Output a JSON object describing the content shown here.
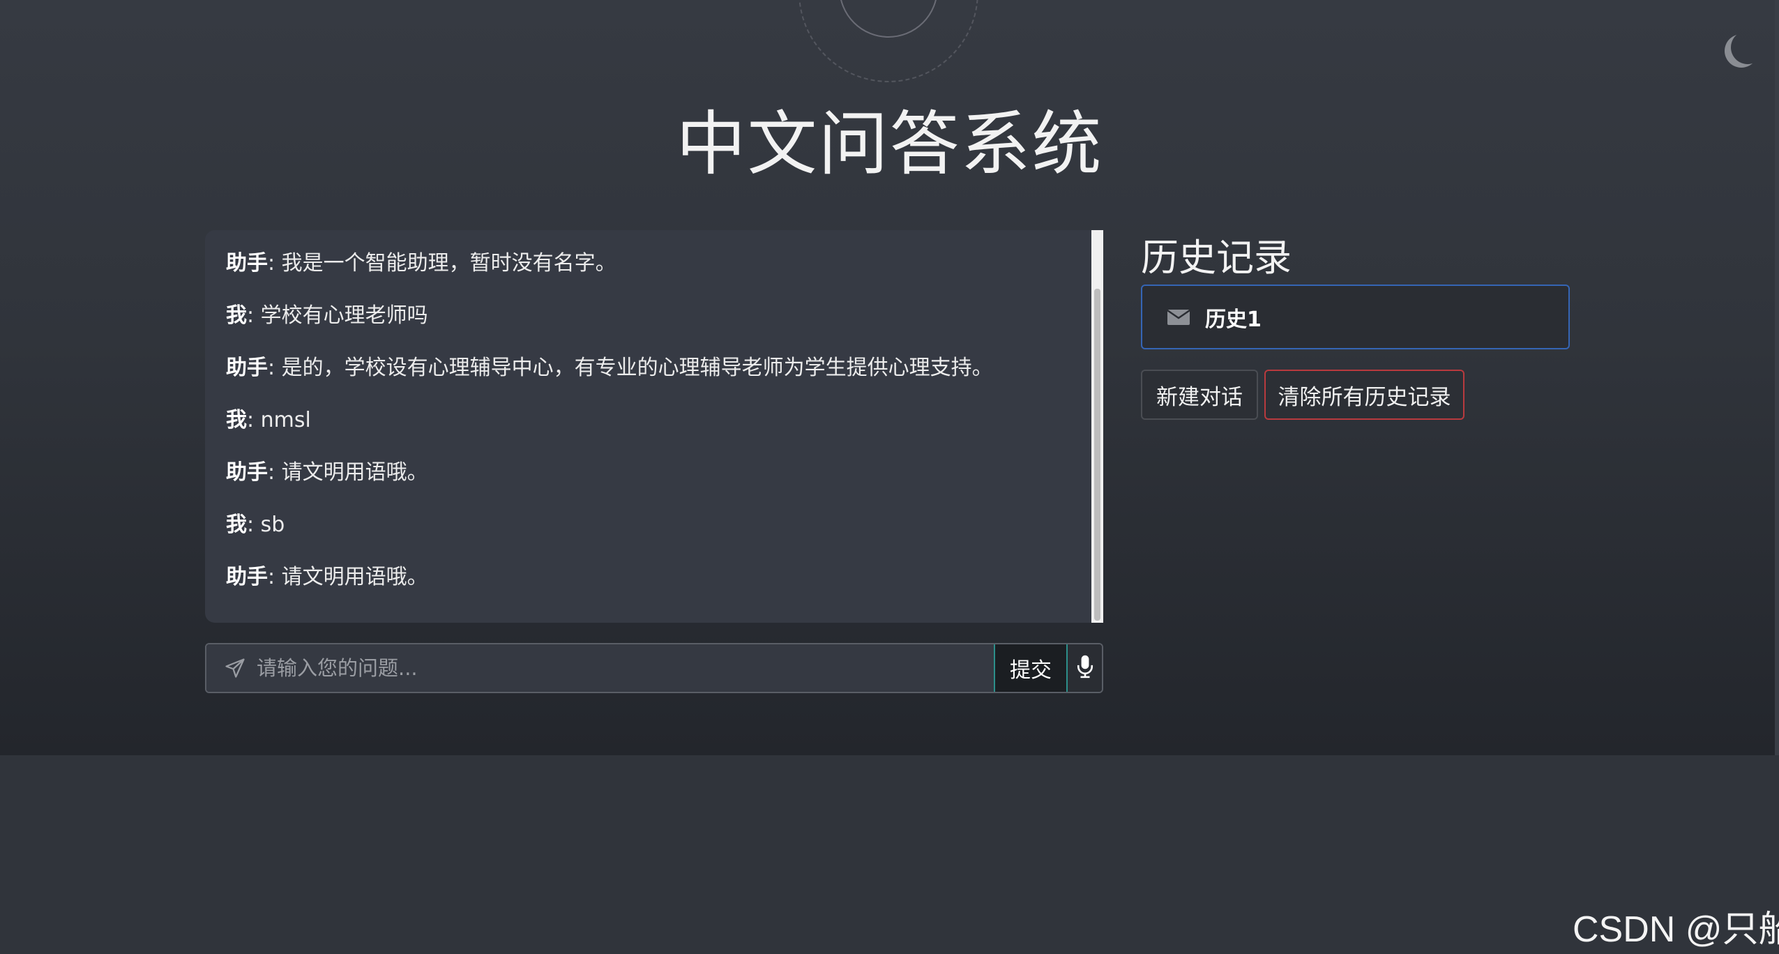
{
  "header": {
    "title": "中文问答系统"
  },
  "chat": {
    "messages": [
      {
        "speaker": "助手",
        "text": ": 我是一个智能助理，暂时没有名字。"
      },
      {
        "speaker": "我",
        "text": ": 学校有心理老师吗"
      },
      {
        "speaker": "助手",
        "text": ": 是的，学校设有心理辅导中心，有专业的心理辅导老师为学生提供心理支持。"
      },
      {
        "speaker": "我",
        "text": ": nmsl"
      },
      {
        "speaker": "助手",
        "text": ": 请文明用语哦。"
      },
      {
        "speaker": "我",
        "text": ": sb"
      },
      {
        "speaker": "助手",
        "text": ": 请文明用语哦。"
      }
    ]
  },
  "input": {
    "placeholder": "请输入您的问题...",
    "value": "",
    "submit_label": "提交"
  },
  "history": {
    "title": "历史记录",
    "items": [
      {
        "label": "历史1",
        "icon": "envelope-icon"
      }
    ],
    "new_button": "新建对话",
    "clear_button": "清除所有历史记录"
  },
  "watermark": "CSDN @只船",
  "colors": {
    "accent_border": "#3565b5",
    "danger_border": "#b83a3e",
    "submit_border": "#2c8f8a"
  }
}
